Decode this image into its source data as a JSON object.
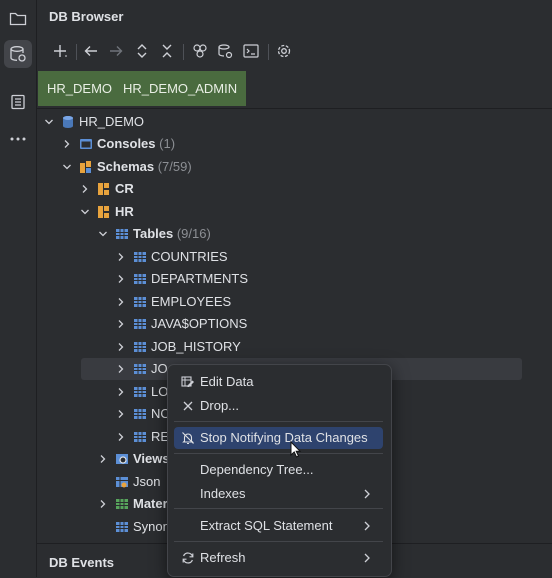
{
  "panel": {
    "title": "DB Browser",
    "bottom_panel": "DB Events"
  },
  "toolbar": {
    "icons": [
      "add-icon",
      "back-icon",
      "forward-icon",
      "expand-icon",
      "collapse-icon",
      "schema-objects-icon",
      "db-settings-icon",
      "console-icon",
      "settings-icon"
    ]
  },
  "connections": [
    "HR_DEMO",
    "HR_DEMO_ADMIN"
  ],
  "tree": {
    "root": "HR_DEMO",
    "consoles": {
      "label": "Consoles",
      "count": "(1)"
    },
    "schemas": {
      "label": "Schemas",
      "count": "(7/59)"
    },
    "schema_cr": "CR",
    "schema_hr": "HR",
    "tables": {
      "label": "Tables",
      "count": "(9/16)"
    },
    "table_items": [
      "COUNTRIES",
      "DEPARTMENTS",
      "EMPLOYEES",
      "JAVA$OPTIONS",
      "JOB_HISTORY",
      "JO",
      "LO",
      "NO",
      "RE"
    ],
    "views": "Views",
    "json": "Json",
    "mater": "Mater",
    "synon": "Synon"
  },
  "context_menu": {
    "items": [
      {
        "label": "Edit Data",
        "icon": "edit-table-icon"
      },
      {
        "label": "Drop...",
        "icon": "close-icon"
      },
      {
        "label": "Stop Notifying Data Changes",
        "icon": "bell-off-icon",
        "selected": true
      },
      {
        "label": "Dependency Tree..."
      },
      {
        "label": "Indexes",
        "submenu": true
      },
      {
        "label": "Extract SQL Statement",
        "submenu": true
      },
      {
        "label": "Refresh",
        "icon": "refresh-icon",
        "submenu": true
      }
    ]
  },
  "colors": {
    "background": "#2b2d30",
    "connection_tab": "#4a6b3f",
    "selection": "#2e436e",
    "folder_orange": "#e8a33d",
    "table_blue": "#5c8fd6"
  }
}
